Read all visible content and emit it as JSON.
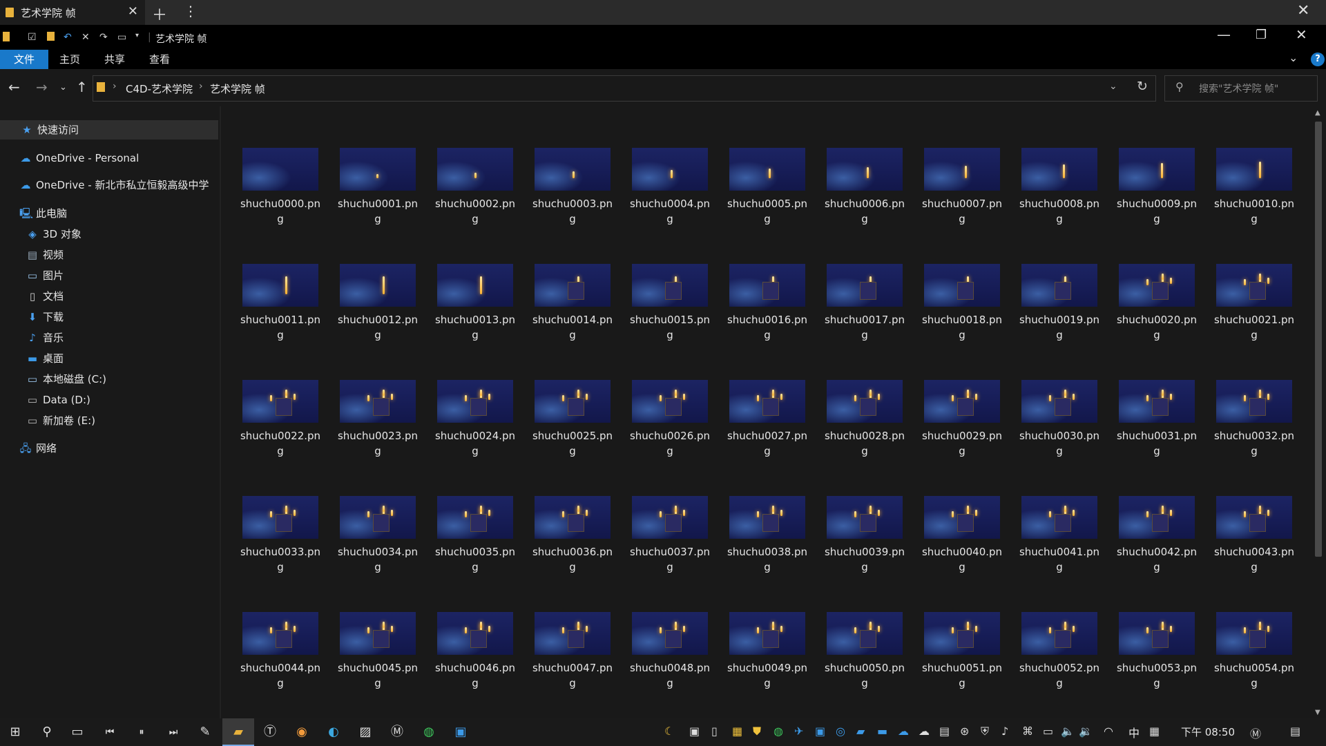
{
  "tab": {
    "title": "艺术学院 帧"
  },
  "titlebar": {
    "title": "艺术学院 帧"
  },
  "ribbon": {
    "tabs": [
      "文件",
      "主页",
      "共享",
      "查看"
    ],
    "help": "?"
  },
  "address": {
    "crumbs": [
      "C4D-艺术学院",
      "艺术学院 帧"
    ],
    "search_placeholder": "搜索\"艺术学院 帧\""
  },
  "sidebar": {
    "quick_access": "快速访问",
    "onedrive_personal": "OneDrive - Personal",
    "onedrive_school": "OneDrive - 新北市私立恒毅高级中学",
    "this_pc": "此电脑",
    "pc_items": [
      "3D 对象",
      "视频",
      "图片",
      "文档",
      "下载",
      "音乐",
      "桌面",
      "本地磁盘 (C:)",
      "Data (D:)",
      "新加卷 (E:)"
    ],
    "network": "网络"
  },
  "files": [
    "shuchu0000.png",
    "shuchu0001.png",
    "shuchu0002.png",
    "shuchu0003.png",
    "shuchu0004.png",
    "shuchu0005.png",
    "shuchu0006.png",
    "shuchu0007.png",
    "shuchu0008.png",
    "shuchu0009.png",
    "shuchu0010.png",
    "shuchu0011.png",
    "shuchu0012.png",
    "shuchu0013.png",
    "shuchu0014.png",
    "shuchu0015.png",
    "shuchu0016.png",
    "shuchu0017.png",
    "shuchu0018.png",
    "shuchu0019.png",
    "shuchu0020.png",
    "shuchu0021.png",
    "shuchu0022.png",
    "shuchu0023.png",
    "shuchu0024.png",
    "shuchu0025.png",
    "shuchu0026.png",
    "shuchu0027.png",
    "shuchu0028.png",
    "shuchu0029.png",
    "shuchu0030.png",
    "shuchu0031.png",
    "shuchu0032.png",
    "shuchu0033.png",
    "shuchu0034.png",
    "shuchu0035.png",
    "shuchu0036.png",
    "shuchu0037.png",
    "shuchu0038.png",
    "shuchu0039.png",
    "shuchu0040.png",
    "shuchu0041.png",
    "shuchu0042.png",
    "shuchu0043.png",
    "shuchu0044.png",
    "shuchu0045.png",
    "shuchu0046.png",
    "shuchu0047.png",
    "shuchu0048.png",
    "shuchu0049.png",
    "shuchu0050.png",
    "shuchu0051.png",
    "shuchu0052.png",
    "shuchu0053.png",
    "shuchu0054.png"
  ],
  "taskbar": {
    "clock": "下午 08:50",
    "ime": "中"
  },
  "colors": {
    "accent": "#1979ca",
    "folder": "#e8b23c",
    "flame": "#ffb231",
    "thumb_bg": "#1a2160"
  }
}
